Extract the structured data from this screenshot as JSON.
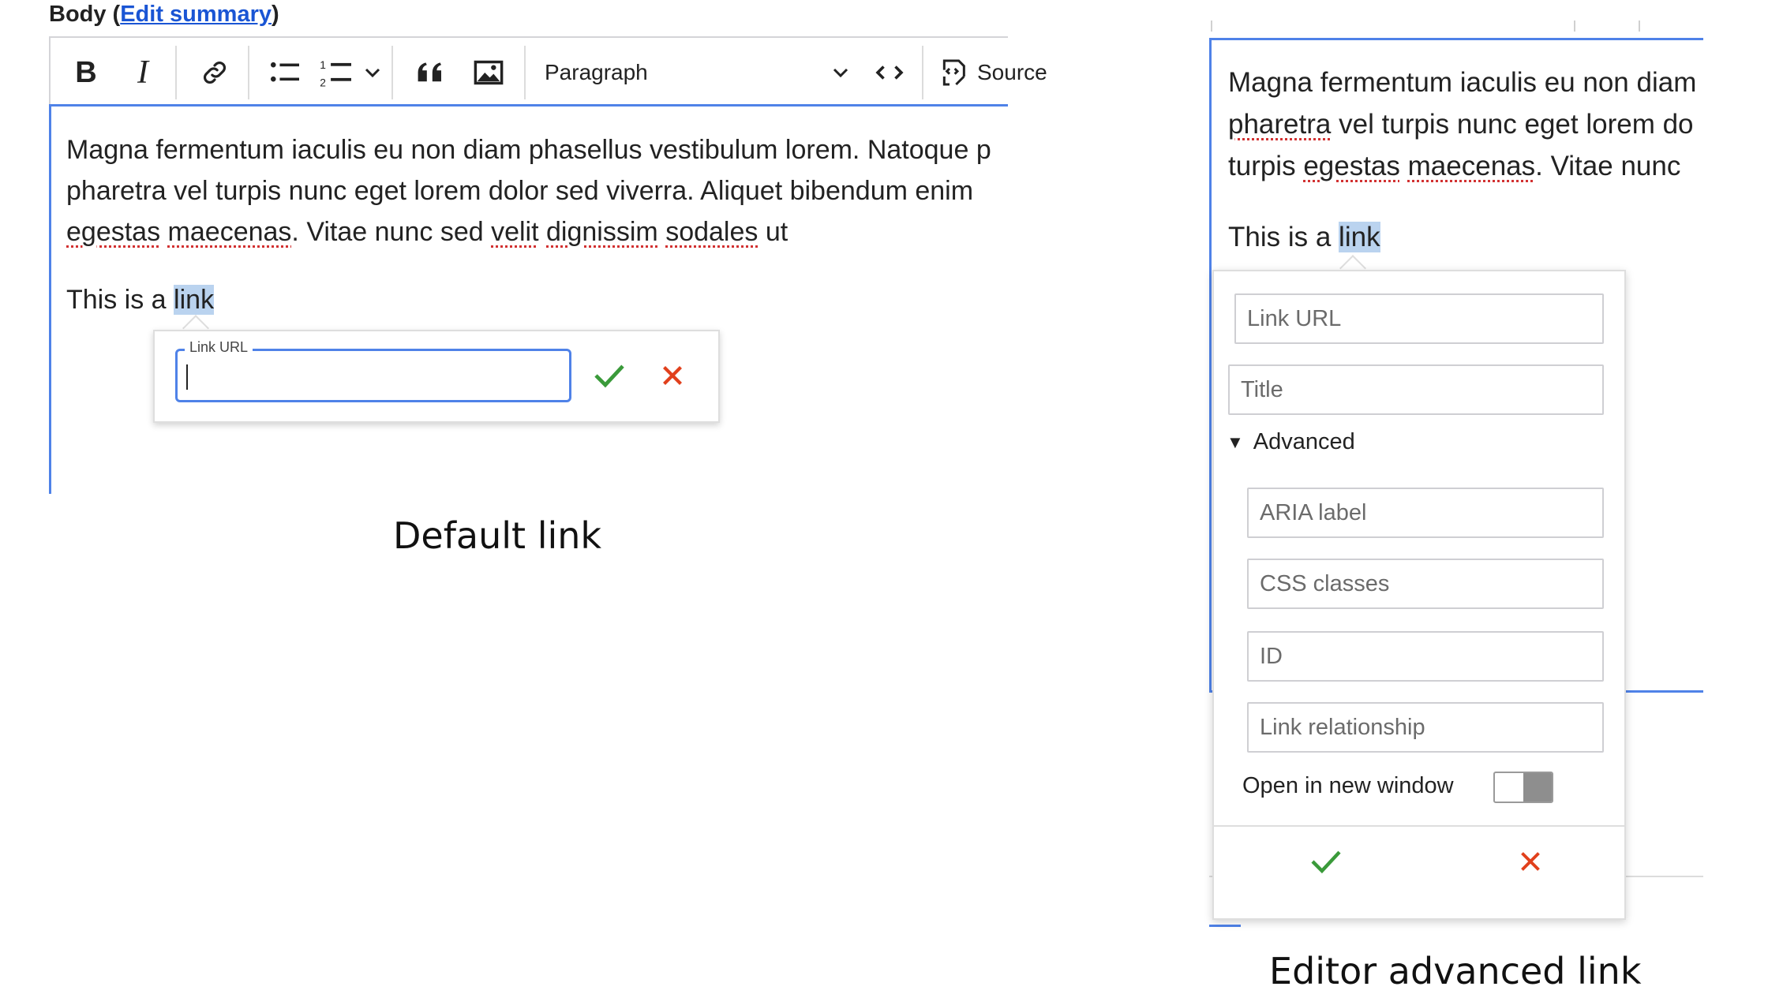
{
  "left_example": {
    "field_label": "Body",
    "edit_summary_link": "Edit summary",
    "toolbar": {
      "icons": [
        "bold-icon",
        "italic-icon",
        "link-icon",
        "bulleted-list-icon",
        "numbered-list-icon",
        "chevron-down-icon",
        "blockquote-icon",
        "image-icon",
        "chevron-down-icon",
        "code-icon",
        "source-icon"
      ],
      "bold_label": "B",
      "italic_label": "I",
      "heading_select": "Paragraph",
      "source_label": "Source"
    },
    "paragraph1": {
      "line1": "Magna fermentum iaculis eu non diam phasellus vestibulum lorem. Natoque p",
      "line2": "pharetra vel turpis nunc eget lorem dolor sed viverra. Aliquet bibendum enim",
      "line3_words": [
        "egestas",
        " ",
        "maecenas",
        ". Vitae nunc sed ",
        "velit",
        " ",
        "dignissim",
        " ",
        "sodales",
        " ut"
      ]
    },
    "paragraph2": {
      "prefix": "This is a ",
      "selected": "link"
    },
    "link_popup": {
      "field_label": "Link URL",
      "field_value": "",
      "confirm_icon": "checkmark-icon",
      "cancel_icon": "close-icon",
      "confirm_color": "#3a9a3a",
      "cancel_color": "#e1401c"
    },
    "caption": "Default link"
  },
  "right_example": {
    "paragraph1": {
      "line1": "Magna fermentum iaculis eu non diam",
      "line2_word": "pharetra",
      "line2_rest": " vel turpis nunc eget lorem do",
      "line3_prefix": "turpis ",
      "line3_words": [
        "egestas",
        " ",
        "maecenas"
      ],
      "line3_rest": ". Vitae nunc"
    },
    "paragraph2": {
      "prefix": "This is a ",
      "selected": "link"
    },
    "link_popup": {
      "fields": [
        {
          "placeholder": "Link URL",
          "value": ""
        },
        {
          "placeholder": "Title",
          "value": ""
        }
      ],
      "advanced_label": "Advanced",
      "advanced_expanded": true,
      "advanced_fields": [
        {
          "placeholder": "ARIA label",
          "value": ""
        },
        {
          "placeholder": "CSS classes",
          "value": ""
        },
        {
          "placeholder": "ID",
          "value": ""
        },
        {
          "placeholder": "Link relationship",
          "value": ""
        }
      ],
      "open_new_window_label": "Open in new window",
      "open_new_window_on": false,
      "confirm_icon": "checkmark-icon",
      "cancel_icon": "close-icon"
    },
    "caption": "Editor advanced link"
  },
  "colors": {
    "focus_blue": "#4f82e8",
    "link_blue": "#1a55d4",
    "selection": "#bad3ef",
    "spell_error": "#d23131"
  }
}
